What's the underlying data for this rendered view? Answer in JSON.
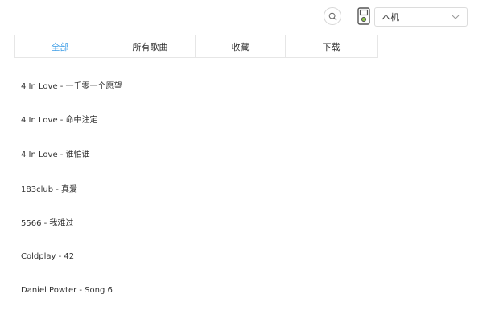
{
  "header": {
    "search_icon": "search-icon",
    "device_icon": "ipod-device-icon",
    "device_select": {
      "value": "本机",
      "chevron_icon": "chevron-down-icon"
    }
  },
  "tabs": [
    {
      "label": "全部",
      "active": true
    },
    {
      "label": "所有歌曲",
      "active": false
    },
    {
      "label": "收藏",
      "active": false
    },
    {
      "label": "下载",
      "active": false
    }
  ],
  "songs": [
    {
      "label": "4 In Love - 一千零一个愿望"
    },
    {
      "label": "4 In Love - 命中注定"
    },
    {
      "label": "4 In Love - 谁怕谁"
    },
    {
      "label": "183club - 真爱"
    },
    {
      "label": "5566 - 我难过"
    },
    {
      "label": "Coldplay - 42"
    },
    {
      "label": "Daniel Powter - Song 6"
    }
  ],
  "colors": {
    "accent": "#3b9ce6",
    "device_icon_green": "#8bc34a",
    "text": "#333333",
    "border": "#e6e6e6"
  }
}
